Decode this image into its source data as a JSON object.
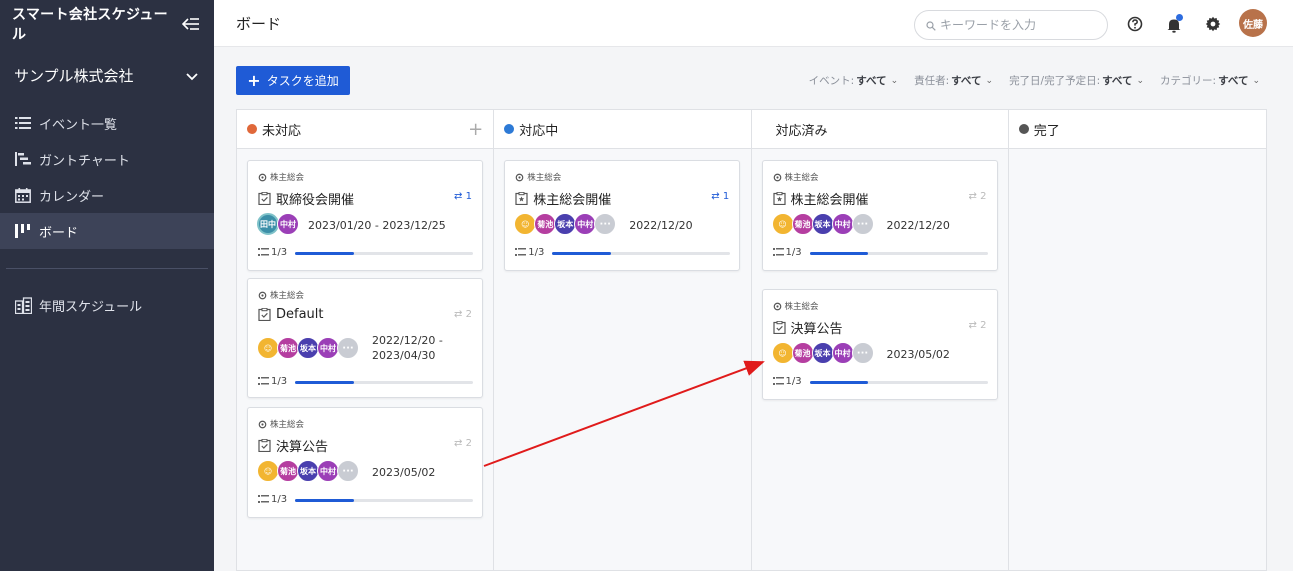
{
  "sidebar": {
    "app_title": "スマート会社スケジュール",
    "org_name": "サンプル株式会社",
    "items": [
      {
        "label": "イベント一覧",
        "icon": "list-icon"
      },
      {
        "label": "ガントチャート",
        "icon": "gantt-icon"
      },
      {
        "label": "カレンダー",
        "icon": "calendar-icon"
      },
      {
        "label": "ボード",
        "icon": "board-icon",
        "active": true
      }
    ],
    "bottom_items": [
      {
        "label": "年間スケジュール",
        "icon": "annual-schedule-icon"
      }
    ]
  },
  "header": {
    "title": "ボード",
    "search_placeholder": "キーワードを入力",
    "avatar": "佐藤"
  },
  "toolbar": {
    "add_task": "タスクを追加",
    "filters": [
      {
        "label": "イベント:",
        "value": "すべて"
      },
      {
        "label": "責任者:",
        "value": "すべて"
      },
      {
        "label": "完了日/完了予定日:",
        "value": "すべて"
      },
      {
        "label": "カテゴリー:",
        "value": "すべて"
      }
    ]
  },
  "columns": [
    {
      "name": "未対応",
      "color": "#e0683a"
    },
    {
      "name": "対応中",
      "color": "#2d7ad6"
    },
    {
      "name": "対応済み",
      "color": ""
    },
    {
      "name": "完了",
      "color": "#555555"
    }
  ],
  "cards": {
    "c1": {
      "category": "株主総会",
      "title": "取締役会開催",
      "links": "1",
      "date": "2023/01/20 - 2023/12/25",
      "progress": "1/3",
      "progress_value": 0.33,
      "members": [
        "田中",
        "中村"
      ]
    },
    "c2": {
      "category": "株主総会",
      "title": "Default",
      "links": "2",
      "date1": "2022/12/20 -",
      "date2": "2023/04/30",
      "progress": "1/3",
      "progress_value": 0.33,
      "members": [
        "菊池",
        "坂本",
        "中村"
      ]
    },
    "c3": {
      "category": "株主総会",
      "title": "決算公告",
      "links": "2",
      "date": "2023/05/02",
      "progress": "1/3",
      "progress_value": 0.33,
      "members": [
        "菊池",
        "坂本",
        "中村"
      ]
    },
    "c4": {
      "category": "株主総会",
      "title": "株主総会開催",
      "links": "1",
      "date": "2022/12/20",
      "progress": "1/3",
      "progress_value": 0.33,
      "members": [
        "菊池",
        "坂本",
        "中村"
      ]
    },
    "c5": {
      "category": "株主総会",
      "title": "株主総会開催",
      "links": "2",
      "date": "2022/12/20",
      "progress": "1/3",
      "progress_value": 0.33,
      "members": [
        "菊池",
        "坂本",
        "中村"
      ]
    },
    "c6": {
      "category": "株主総会",
      "title": "決算公告",
      "links": "2",
      "date": "2023/05/02",
      "progress": "1/3",
      "progress_value": 0.33,
      "members": [
        "菊池",
        "坂本",
        "中村"
      ]
    }
  },
  "colors": {
    "accent": "#1f5bd6",
    "sidebar": "#2c3142",
    "arrow": "#e01b1b",
    "member_kikuchi": "#b53ea0",
    "member_sakamoto": "#4a3fae",
    "member_nakamura": "#9b3fb7",
    "member_tanaka": "#3c8fa8"
  }
}
